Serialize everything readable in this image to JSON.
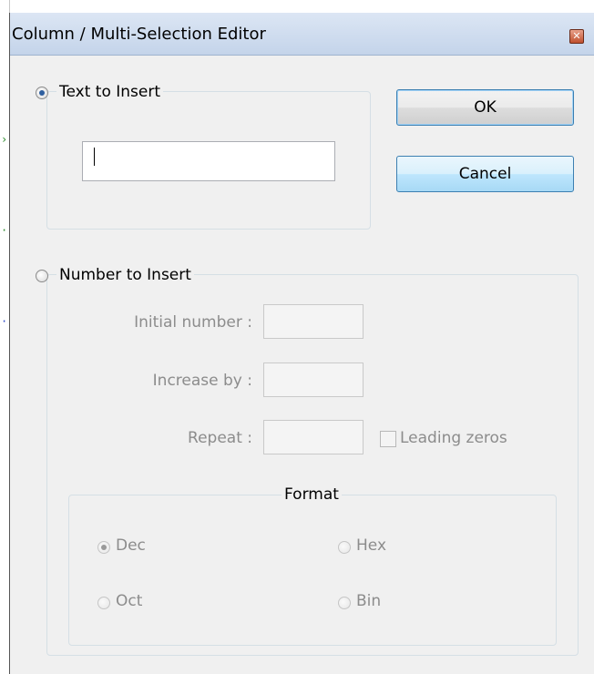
{
  "dialog": {
    "title": "Column / Multi-Selection Editor",
    "text_section": {
      "label": "Text to Insert",
      "input_value": ""
    },
    "buttons": {
      "ok": "OK",
      "cancel": "Cancel"
    },
    "number_section": {
      "label": "Number to Insert",
      "initial_label": "Initial number :",
      "increase_label": "Increase by :",
      "repeat_label": "Repeat :",
      "leading_zeros": "Leading zeros",
      "format": {
        "label": "Format",
        "options": [
          "Dec",
          "Hex",
          "Oct",
          "Bin"
        ],
        "selected": "Dec"
      }
    }
  },
  "colors": {
    "title_bar": "#c4d4ea",
    "dialog_bg": "#f0f0f0",
    "disabled_text": "#8c8c8c",
    "close_button": "#c0502e"
  },
  "icons": [
    "close-icon"
  ]
}
